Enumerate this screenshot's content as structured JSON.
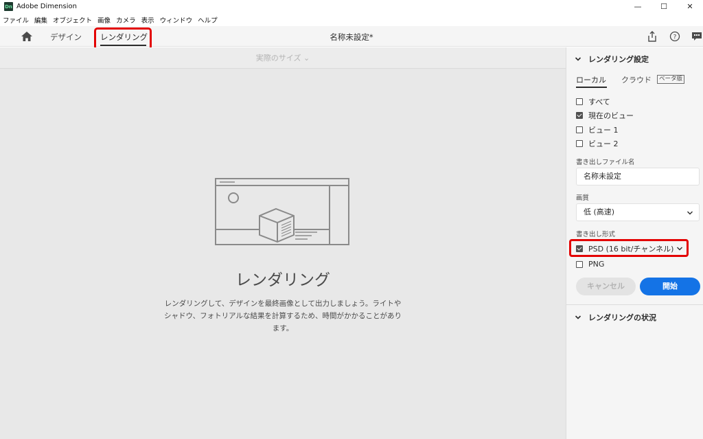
{
  "window": {
    "app_icon": "Dn",
    "title": "Adobe Dimension",
    "minimize": "—",
    "maximize": "☐",
    "close": "✕"
  },
  "menu": [
    "ファイル",
    "編集",
    "オブジェクト",
    "画像",
    "カメラ",
    "表示",
    "ウィンドウ",
    "ヘルプ"
  ],
  "header": {
    "tabs": [
      "デザイン",
      "レンダリング"
    ],
    "active_tab": "レンダリング",
    "doc_title": "名称未設定*",
    "icons": [
      "home-icon",
      "share-icon",
      "help-icon",
      "feedback-icon"
    ]
  },
  "canvas": {
    "size_dropdown": "実際のサイズ ⌄",
    "empty_title": "レンダリング",
    "empty_desc": "レンダリングして、デザインを最終画像として出力しましょう。ライトやシャドウ、フォトリアルな結果を計算するため、時間がかかることがあります。"
  },
  "panel": {
    "render_settings": "レンダリング設定",
    "tab_local": "ローカル",
    "tab_cloud": "クラウド",
    "beta": "ベータ版",
    "views": [
      {
        "label": "すべて",
        "checked": false
      },
      {
        "label": "現在のビュー",
        "checked": true
      },
      {
        "label": "ビュー 1",
        "checked": false
      },
      {
        "label": "ビュー 2",
        "checked": false
      }
    ],
    "filename_label": "書き出しファイル名",
    "filename_value": "名称未設定",
    "quality_label": "画質",
    "quality_value": "低 (高速)",
    "format_label": "書き出し形式",
    "formats": [
      {
        "label": "PSD (16 bit/チャンネル)",
        "checked": true
      },
      {
        "label": "PNG",
        "checked": false
      }
    ],
    "cancel_label": "キャンセル",
    "start_label": "開始",
    "render_status": "レンダリングの状況"
  },
  "colors": {
    "accent": "#1473e6",
    "highlight": "#e30000"
  }
}
